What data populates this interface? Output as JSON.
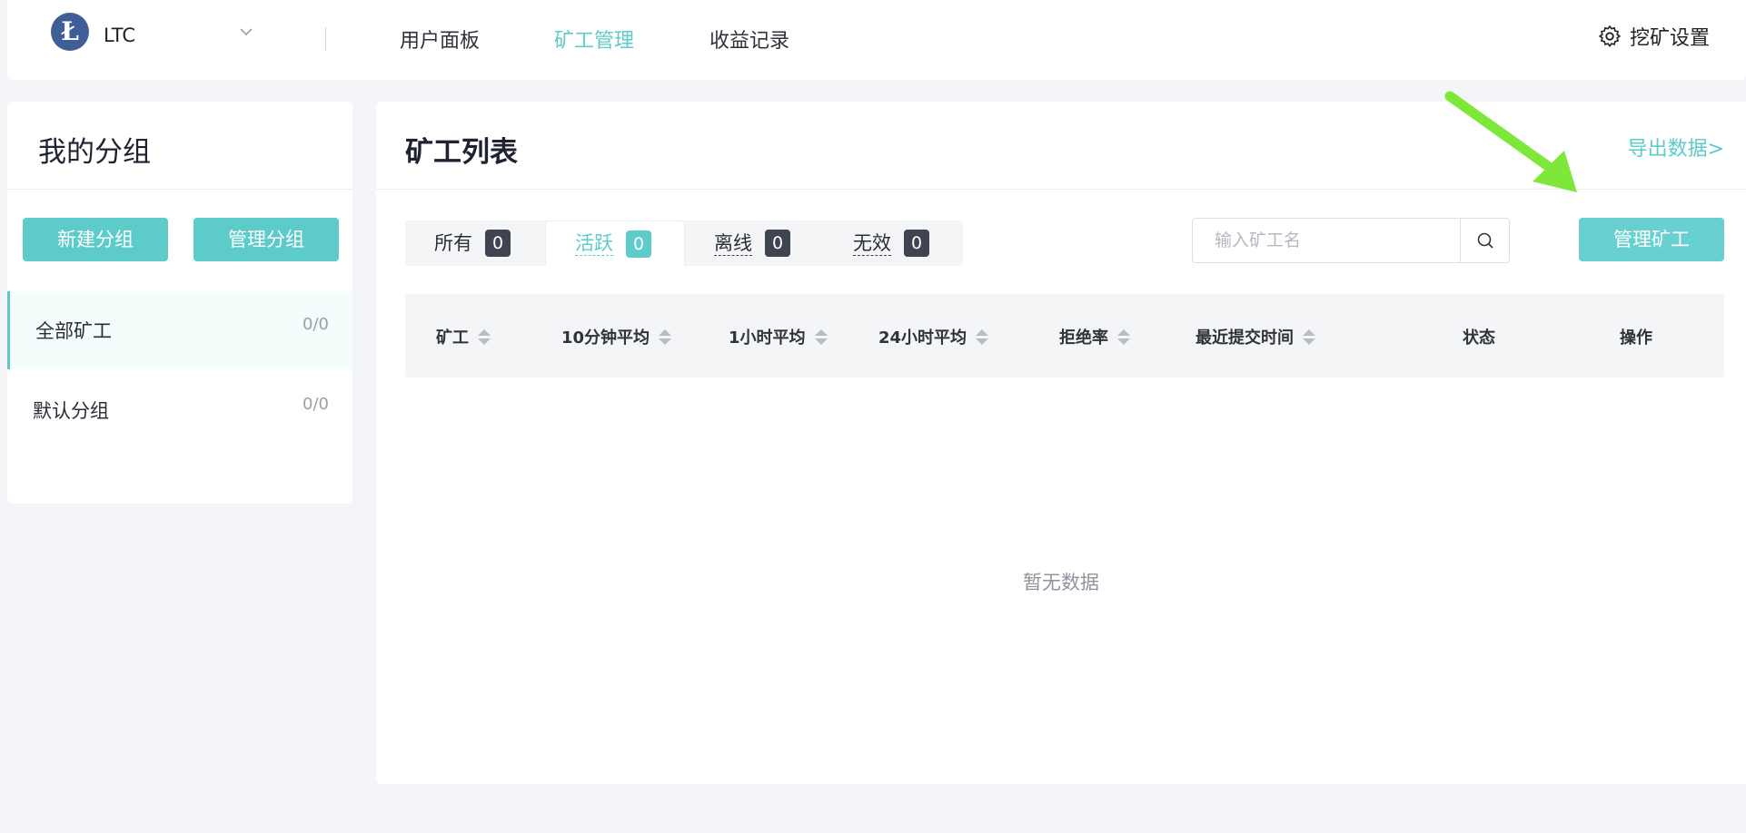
{
  "topbar": {
    "coin": "LTC",
    "nav": [
      "用户面板",
      "矿工管理",
      "收益记录"
    ],
    "active_nav": "矿工管理",
    "settings_label": "挖矿设置"
  },
  "sidebar": {
    "title": "我的分组",
    "new_group": "新建分组",
    "manage_group": "管理分组",
    "groups": [
      {
        "name": "全部矿工",
        "count": "0/0"
      },
      {
        "name": "默认分组",
        "count": "0/0"
      }
    ]
  },
  "main": {
    "title": "矿工列表",
    "export": "导出数据>",
    "tabs": [
      {
        "label": "所有",
        "count": "0"
      },
      {
        "label": "活跃",
        "count": "0"
      },
      {
        "label": "离线",
        "count": "0"
      },
      {
        "label": "无效",
        "count": "0"
      }
    ],
    "active_tab": "活跃",
    "search_placeholder": "输入矿工名",
    "manage_miner": "管理矿工",
    "columns": [
      "矿工",
      "10分钟平均",
      "1小时平均",
      "24小时平均",
      "拒绝率",
      "最近提交时间",
      "状态",
      "操作"
    ],
    "empty_text": "暂无数据"
  },
  "colors": {
    "accent": "#5ecbcb",
    "arrow": "#7ee83a",
    "logo": "#3f5d96"
  },
  "icons": [
    "litecoin-logo",
    "chevron-down-icon",
    "gear-icon",
    "search-icon",
    "sort-icon",
    "annotation-arrow"
  ]
}
